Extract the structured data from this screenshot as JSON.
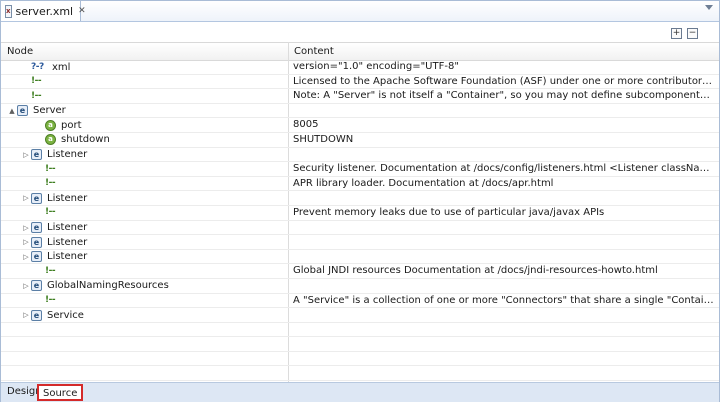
{
  "editor": {
    "tab_label": "server.xml",
    "tab_close": "✕",
    "tab_icon": "x",
    "expand_all": "+",
    "collapse_all": "−"
  },
  "table": {
    "headers": {
      "node": "Node",
      "content": "Content"
    },
    "rows": [
      {
        "indent": 1,
        "twisty": "",
        "icon": "pi",
        "icon_text": "?-?",
        "label": "xml",
        "content": "version=\"1.0\" encoding=\"UTF-8\""
      },
      {
        "indent": 1,
        "twisty": "",
        "icon": "comment",
        "icon_text": "!--",
        "label": "",
        "content": "  Licensed to the Apache Software Foundation (ASF) under one or more  contributor license a..."
      },
      {
        "indent": 1,
        "twisty": "",
        "icon": "comment",
        "icon_text": "!--",
        "label": "",
        "content": "  Note:  A \"Server\" is not itself a \"Container\", so you may not     define subcomponents such a..."
      },
      {
        "indent": 0,
        "twisty": "▲",
        "icon": "element",
        "icon_text": "e",
        "label": "Server",
        "content": ""
      },
      {
        "indent": 2,
        "twisty": "",
        "icon": "attr",
        "icon_text": "a",
        "label": "port",
        "content": "8005"
      },
      {
        "indent": 2,
        "twisty": "",
        "icon": "attr",
        "icon_text": "a",
        "label": "shutdown",
        "content": "SHUTDOWN"
      },
      {
        "indent": 1,
        "twisty": "▷",
        "icon": "element",
        "icon_text": "e",
        "label": "Listener",
        "content": ""
      },
      {
        "indent": 2,
        "twisty": "",
        "icon": "comment",
        "icon_text": "!--",
        "label": "",
        "content": " Security listener. Documentation at /docs/config/listeners.html   <Listener className=\"org.ap..."
      },
      {
        "indent": 2,
        "twisty": "",
        "icon": "comment",
        "icon_text": "!--",
        "label": "",
        "content": "APR library loader. Documentation at /docs/apr.html"
      },
      {
        "indent": 1,
        "twisty": "▷",
        "icon": "element",
        "icon_text": "e",
        "label": "Listener",
        "content": ""
      },
      {
        "indent": 2,
        "twisty": "",
        "icon": "comment",
        "icon_text": "!--",
        "label": "",
        "content": " Prevent memory leaks due to use of particular java/javax APIs"
      },
      {
        "indent": 1,
        "twisty": "▷",
        "icon": "element",
        "icon_text": "e",
        "label": "Listener",
        "content": ""
      },
      {
        "indent": 1,
        "twisty": "▷",
        "icon": "element",
        "icon_text": "e",
        "label": "Listener",
        "content": ""
      },
      {
        "indent": 1,
        "twisty": "▷",
        "icon": "element",
        "icon_text": "e",
        "label": "Listener",
        "content": ""
      },
      {
        "indent": 2,
        "twisty": "",
        "icon": "comment",
        "icon_text": "!--",
        "label": "",
        "content": " Global JNDI resources        Documentation at /docs/jndi-resources-howto.html"
      },
      {
        "indent": 1,
        "twisty": "▷",
        "icon": "element",
        "icon_text": "e",
        "label": "GlobalNamingResources",
        "content": ""
      },
      {
        "indent": 2,
        "twisty": "",
        "icon": "comment",
        "icon_text": "!--",
        "label": "",
        "content": " A \"Service\" is a collection of one or more \"Connectors\" that share       a single \"Container\" N..."
      },
      {
        "indent": 1,
        "twisty": "▷",
        "icon": "element",
        "icon_text": "e",
        "label": "Service",
        "content": ""
      },
      {
        "indent": 0,
        "twisty": "",
        "icon": "",
        "icon_text": "",
        "label": "",
        "content": ""
      },
      {
        "indent": 0,
        "twisty": "",
        "icon": "",
        "icon_text": "",
        "label": "",
        "content": ""
      },
      {
        "indent": 0,
        "twisty": "",
        "icon": "",
        "icon_text": "",
        "label": "",
        "content": ""
      },
      {
        "indent": 0,
        "twisty": "",
        "icon": "",
        "icon_text": "",
        "label": "",
        "content": ""
      }
    ]
  },
  "bottom_tabs": {
    "design": "Design",
    "source": "Source"
  },
  "colors": {
    "active_tab_outline": "#d42a2a",
    "bottom_bar": "#dde7f4"
  }
}
